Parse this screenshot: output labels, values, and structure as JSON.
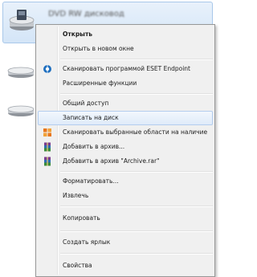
{
  "drive": {
    "label": "DVD RW дисковод"
  },
  "menu": {
    "items": [
      {
        "label": "Открыть"
      },
      {
        "label": "Открыть в новом окне"
      },
      {
        "label": "Сканировать программой ESET Endpoint"
      },
      {
        "label": "Расширенные функции"
      },
      {
        "label": "Общий доступ"
      },
      {
        "label": "Записать на диск"
      },
      {
        "label": "Сканировать выбранные области на наличие"
      },
      {
        "label": "Добавить в архив..."
      },
      {
        "label": "Добавить в архив \"Archive.rar\""
      },
      {
        "label": "Форматировать..."
      },
      {
        "label": "Извлечь"
      },
      {
        "label": "Копировать"
      },
      {
        "label": "Создать ярлык"
      },
      {
        "label": "Свойства"
      }
    ]
  }
}
